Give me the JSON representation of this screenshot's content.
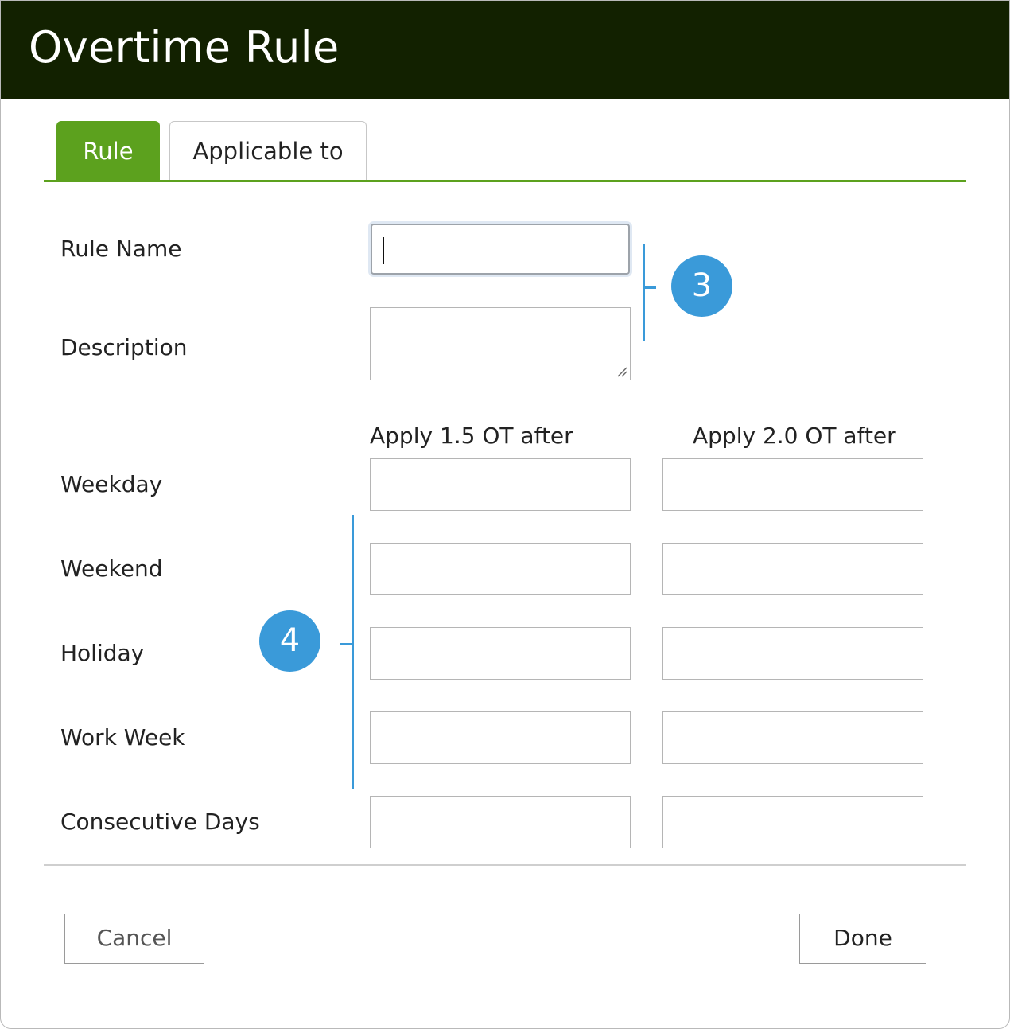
{
  "dialog": {
    "title": "Overtime Rule"
  },
  "tabs": [
    {
      "label": "Rule",
      "active": true
    },
    {
      "label": "Applicable to",
      "active": false
    }
  ],
  "form": {
    "rule_name_label": "Rule Name",
    "rule_name_value": "",
    "description_label": "Description",
    "description_value": "",
    "col_15_header": "Apply 1.5 OT after",
    "col_20_header": "Apply 2.0 OT after",
    "rows": [
      {
        "label": "Weekday",
        "ot15": "",
        "ot20": ""
      },
      {
        "label": "Weekend",
        "ot15": "",
        "ot20": ""
      },
      {
        "label": "Holiday",
        "ot15": "",
        "ot20": ""
      },
      {
        "label": "Work Week",
        "ot15": "",
        "ot20": ""
      },
      {
        "label": "Consecutive Days",
        "ot15": "",
        "ot20": ""
      }
    ]
  },
  "buttons": {
    "cancel": "Cancel",
    "done": "Done"
  },
  "callouts": {
    "badge_top": "3",
    "badge_bottom": "4"
  },
  "colors": {
    "title_bar": "#122100",
    "accent_green": "#5ca11e",
    "callout_blue": "#3a9ad9"
  }
}
